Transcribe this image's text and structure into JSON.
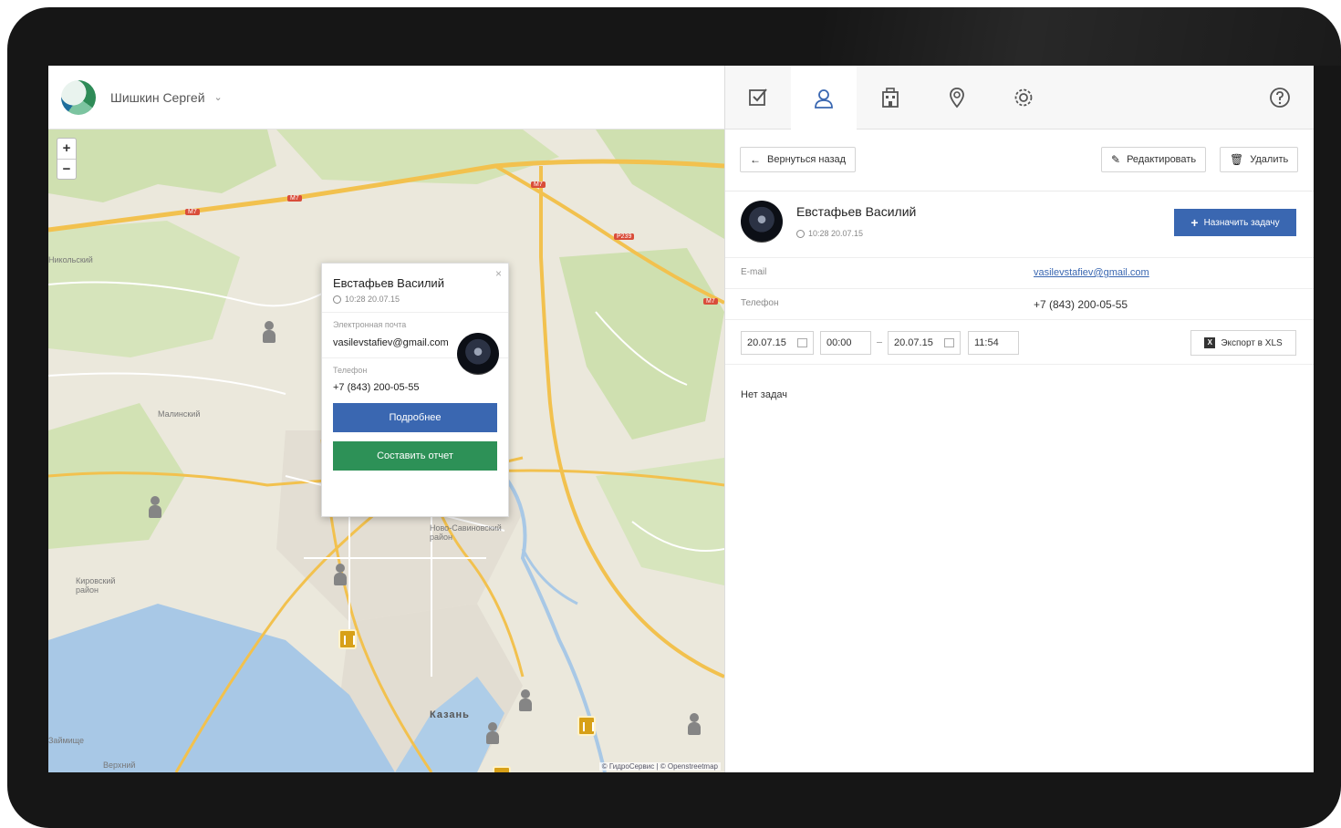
{
  "header": {
    "user_name": "Шишкин Сергей",
    "dropdown_icon": "chevron-down-icon"
  },
  "map": {
    "zoom_in": "+",
    "zoom_out": "−",
    "labels": [
      "Никольский",
      "Малинский",
      "Ново-Савиновский район",
      "Кировский район",
      "Займище",
      "Верхний"
    ],
    "city": "Казань",
    "copyright": "© ГидроСервис | © Openstreetmap",
    "road_badges": [
      "М7",
      "М7",
      "М7",
      "Р239",
      "М7"
    ]
  },
  "popup": {
    "close": "×",
    "name": "Евстафьев Василий",
    "time": "10:28 20.07.15",
    "email_label": "Электронная почта",
    "email": "vasilevstafiev@gmail.com",
    "phone_label": "Телефон",
    "phone": "+7 (843) 200-05-55",
    "details_button": "Подробнее",
    "report_button": "Составить отчет"
  },
  "tabs": [
    {
      "icon": "checkbox-icon",
      "active": false
    },
    {
      "icon": "user-icon",
      "active": true
    },
    {
      "icon": "building-icon",
      "active": false
    },
    {
      "icon": "location-pin-icon",
      "active": false
    },
    {
      "icon": "gear-icon",
      "active": false
    },
    {
      "icon": "help-icon",
      "active": false
    }
  ],
  "toolbar": {
    "back_label": "Вернуться назад",
    "edit_label": "Редактировать",
    "delete_label": "Удалить"
  },
  "person": {
    "name": "Евстафьев Василий",
    "time": "10:28 20.07.15",
    "assign_label": "Назначить задачу"
  },
  "info": {
    "email_label": "E-mail",
    "email_value": "vasilevstafiev@gmail.com",
    "phone_label": "Телефон",
    "phone_value": "+7 (843) 200-05-55"
  },
  "filters": {
    "date_from": "20.07.15",
    "time_from": "00:00",
    "date_to": "20.07.15",
    "time_to": "11:54",
    "export_label": "Экспорт в XLS"
  },
  "tasks": {
    "empty_text": "Нет задач"
  },
  "colors": {
    "primary_blue": "#3a67b1",
    "success_green": "#2d9157",
    "pin_gray": "#858585",
    "building_yellow": "#d7a018"
  }
}
